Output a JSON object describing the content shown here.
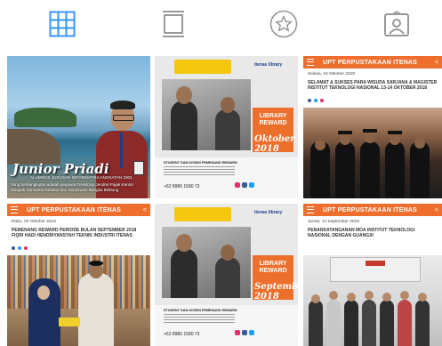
{
  "tabs": [
    {
      "name": "grid",
      "color": "#3897f0"
    },
    {
      "name": "feed",
      "color": "#999999"
    },
    {
      "name": "saved",
      "color": "#999999"
    },
    {
      "name": "tagged",
      "color": "#999999"
    }
  ],
  "posts": {
    "p1": {
      "signature": "Junior Priadi",
      "signature_sub": "ALUMNUS JURUSAN INFORMATIKA ANGKATAN 2004",
      "caption": "Yang bersangkutan adalah pegawai Direktorat Jendral Pajak Kantor Wilayah Sumatera Selatan dan Kepulauan Bangka Belitung"
    },
    "p2": {
      "logo": "itenas library",
      "badge": "LIBRARY REWARD",
      "month": "Oktober 2018",
      "footer_title": "STUDENT DAN DOSEN PEMENANG REWARD",
      "phone": "+62 8986 1580 73"
    },
    "p3": {
      "header": "UPT PERPUSTAKAAN ITENAS",
      "date": "Selasa, 16 Oktober 2018",
      "headline": "SELAMAT & SUKSES PARA WISUDA SARJANA & MAGISTER INSTITUT TEKNOLOGI NASIONAL 13-14 OKTOBER 2018"
    },
    "p4": {
      "header": "UPT PERPUSTAKAAN ITENAS",
      "date": "Rabu, 03 Oktober 2018",
      "headline": "PEMENANG REWARD PERIODE BULAN SEPTEMBER 2018 FIQRI HADI HENDRIYANSYAH TEKNIK INDUSTRI ITENAS"
    },
    "p5": {
      "logo": "itenas library",
      "badge": "LIBRARY REWARD",
      "month": "September 2018",
      "footer_title": "STUDENT DAN DOSEN PEMENANG REWARD",
      "phone": "+62 8986 1580 73"
    },
    "p6": {
      "header": "UPT PERPUSTAKAAN ITENAS",
      "date": "Jumat, 14 September 2018",
      "headline": "PENANDATANGANAN MOA INSTITUT TEKNOLOGI NASIONAL DENGAN GUANGXI"
    }
  },
  "colors": {
    "accent": "#ee6e2e",
    "active_tab": "#3897f0",
    "inactive_tab": "#999999"
  }
}
